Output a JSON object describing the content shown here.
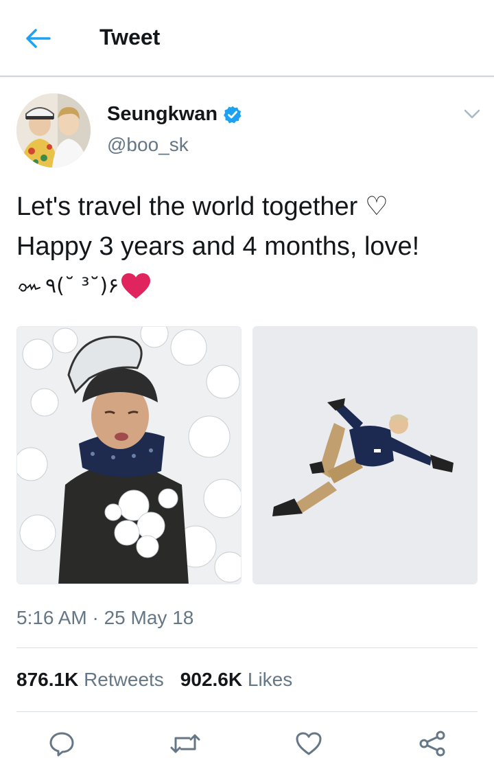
{
  "header": {
    "title": "Tweet",
    "back_icon": "arrow-left-icon",
    "accent_color": "#1da1f2"
  },
  "author": {
    "display_name": "Seungkwan",
    "handle": "@boo_sk",
    "verified": true,
    "verified_color": "#1da1f2"
  },
  "tweet": {
    "lines": [
      "Let's travel the world together ♡",
      "Happy 3 years and 4 months, love!"
    ],
    "kaomoji": "٩(˘ ³˘)۶",
    "heart_color": "#e0245e",
    "media": [
      {
        "description_icon": "photo-snow-helmet"
      },
      {
        "description_icon": "photo-snow-angel"
      }
    ]
  },
  "meta": {
    "timestamp": "5:16 AM · 25 May 18"
  },
  "stats": {
    "retweets_count": "876.1K",
    "retweets_label": "Retweets",
    "likes_count": "902.6K",
    "likes_label": "Likes"
  },
  "actions": [
    {
      "name": "reply-icon"
    },
    {
      "name": "retweet-icon"
    },
    {
      "name": "like-icon"
    },
    {
      "name": "share-icon"
    }
  ],
  "colors": {
    "text_primary": "#14171a",
    "text_secondary": "#657786",
    "icon_gray": "#657786"
  }
}
